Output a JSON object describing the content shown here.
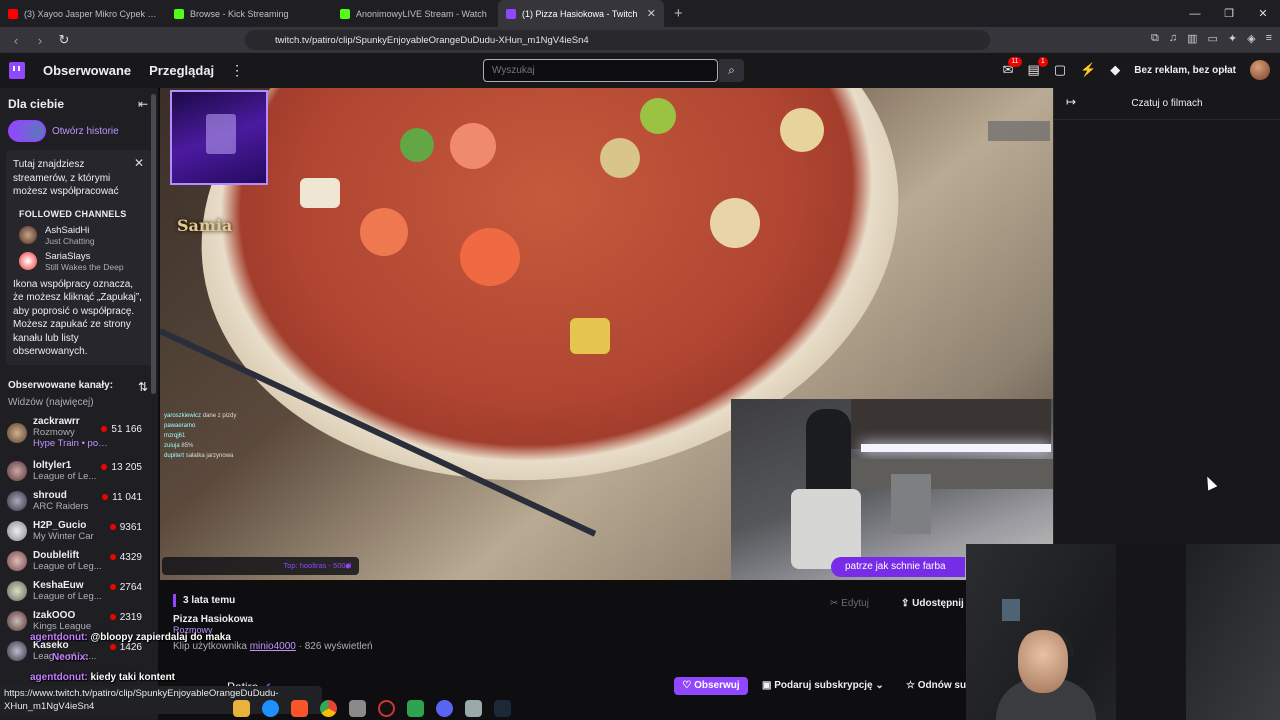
{
  "browser": {
    "tabs": [
      {
        "title": "(3) Xayoo Jasper Mikro Cypek vs de",
        "color": "#ff0000",
        "active": false
      },
      {
        "title": "Browse - Kick Streaming",
        "color": "#53fc18",
        "active": false
      },
      {
        "title": "AnonimowyLIVE Stream - Watch",
        "color": "#53fc18",
        "active": false
      },
      {
        "title": "(1) Pizza Hasiokowa - Twitch",
        "color": "#9147ff",
        "active": true
      }
    ],
    "new_tab": "+",
    "url": "twitch.tv/patiro/clip/SpunkyEnjoyableOrangeDuDudu-XHun_m1NgV4ieSn4"
  },
  "twitch_nav": {
    "following": "Obserwowane",
    "browse": "Przeglądaj",
    "search_placeholder": "Wyszukaj",
    "badge_notifications": "11",
    "badge_inbox": "1",
    "no_ads": "Bez reklam, bez opłat"
  },
  "sidebar": {
    "title": "Dla ciebie",
    "stories_link": "Otwórz historie",
    "info_text": "Tutaj znajdziesz streamerów, z którymi możesz współpracować",
    "followed_channels_header": "FOLLOWED CHANNELS",
    "collab_channels": [
      {
        "name": "AshSaidHi",
        "status": "Just Chatting"
      },
      {
        "name": "SariaSlays",
        "status": "Still Wakes the Deep"
      }
    ],
    "info_text_2": "Ikona współpracy oznacza, że możesz kliknąć „Zapukaj”, aby poprosić o współpracę. Możesz zapukać ze strony kanału lub listy obserwowanych.",
    "followed_header": "Obserwowane kanały:",
    "sort_label": "Widzów (najwięcej)",
    "channels": [
      {
        "name": "zackrawrr",
        "game": "Rozmowy",
        "extra": "Hype Train • pozio...",
        "viewers": "51 166"
      },
      {
        "name": "loltyler1",
        "game": "League of Le...",
        "viewers": "13 205"
      },
      {
        "name": "shroud",
        "game": "ARC Raiders",
        "viewers": "11 041"
      },
      {
        "name": "H2P_Gucio",
        "game": "My Winter Car",
        "viewers": "9361"
      },
      {
        "name": "Doublelift",
        "game": "League of Leg...",
        "viewers": "4329"
      },
      {
        "name": "KeshaEuw",
        "game": "League of Leg...",
        "viewers": "2764"
      },
      {
        "name": "IzakOOO",
        "game": "Kings League",
        "viewers": "2319"
      },
      {
        "name": "Kaseko",
        "game": "League of Le...",
        "viewers": "1426"
      }
    ]
  },
  "video": {
    "overlay_name": "Samia",
    "top_donors": "Top: hooltras - 500zł",
    "chat_bubble": "patrze jak schnie farba",
    "overlay_chat": [
      {
        "user": "yaroszkiewicz",
        "text": "dane z pizdy"
      },
      {
        "user": "pawaeramo",
        "text": ""
      },
      {
        "user": "mzrqj61",
        "text": ""
      },
      {
        "user": "zuluja",
        "text": "85%"
      },
      {
        "user": "dupitert",
        "text": "sałatka jarzynowa"
      }
    ]
  },
  "clip": {
    "age": "3 lata temu",
    "title": "Pizza Hasiokowa",
    "category": "Rozmowy",
    "by_prefix": "Klip użytkownika",
    "by_user": "minio4000",
    "views": "826 wyświetleń",
    "edit": "Edytuj",
    "share": "Udostępnij",
    "streamer": "Patiro",
    "follow": "Obserwuj",
    "subscribe": "Podaruj subskrypcję",
    "gift": "Odnów sub"
  },
  "chat": {
    "title": "Czatuj o filmach"
  },
  "stream_chat": [
    {
      "user": "agentdonut:",
      "text": "@bloopy zapierdalaj do maka"
    },
    {
      "user": "Neonix:",
      "text": ""
    },
    {
      "user": "agentdonut:",
      "text": "kiedy taki kontent"
    }
  ],
  "status_url": "https://www.twitch.tv/patiro/clip/SpunkyEnjoyableOrangeDuDudu-XHun_m1NgV4ieSn4"
}
